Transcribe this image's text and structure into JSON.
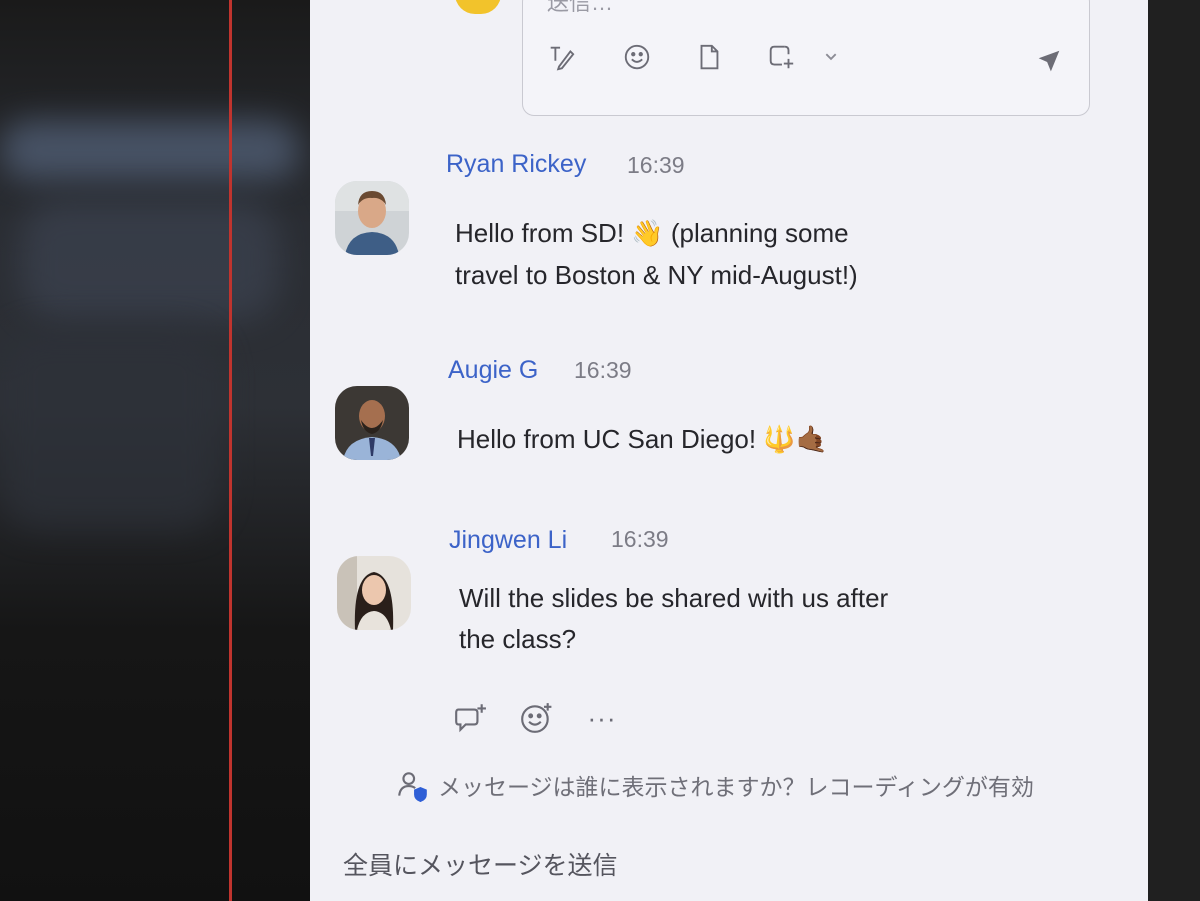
{
  "composer": {
    "placeholder": "送信…",
    "tools": [
      "text-format-icon",
      "emoji-icon",
      "file-icon",
      "screenshot-icon",
      "chevron-down-icon",
      "send-icon"
    ]
  },
  "messages": [
    {
      "sender": "Ryan Rickey",
      "time": "16:39",
      "line1_text": "Hello from SD! ",
      "line1_emoji": "👋",
      "line1_after": " (planning some",
      "line2": "travel to Boston & NY mid-August!)"
    },
    {
      "sender": "Augie G",
      "time": "16:39",
      "text": "Hello from UC San Diego! ",
      "emoji": "🔱🤙🏾"
    },
    {
      "sender": "Jingwen Li",
      "time": "16:39",
      "line1": "Will the slides be shared with us after",
      "line2": "the class?"
    }
  ],
  "message_actions": {
    "more_label": "···"
  },
  "visibility_notice": "メッセージは誰に表示されますか？レコーディングが有効",
  "recipient_label": "全員にメッセージを送信",
  "colors": {
    "accent": "#3c63c8",
    "panel_bg": "#f1f1f6",
    "text": "#26262b",
    "muted": "#7c7c86"
  }
}
